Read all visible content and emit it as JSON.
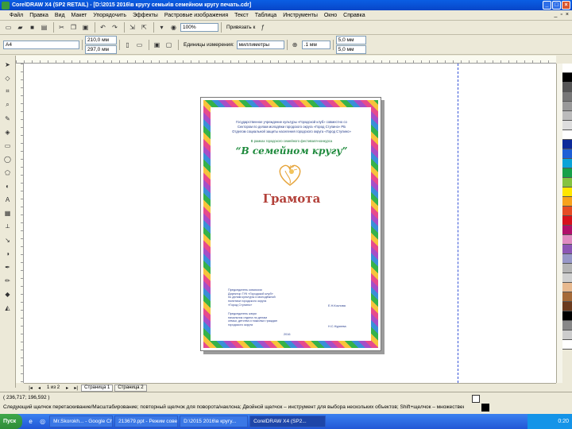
{
  "window": {
    "title": "CorelDRAW X4 (SP2 RETAIL) - [D:\\2015 2016\\в кругу семьи\\в семейном кругу печать.cdr]"
  },
  "menu": {
    "items": [
      "Файл",
      "Правка",
      "Вид",
      "Макет",
      "Упорядочить",
      "Эффекты",
      "Растровые изображения",
      "Текст",
      "Таблица",
      "Инструменты",
      "Окно",
      "Справка"
    ]
  },
  "toolbar1": {
    "zoom": "100%",
    "snap_label": "Привязать к"
  },
  "toolbar2": {
    "paper": "A4",
    "width": "210,0 мм",
    "height": "297,0 мм",
    "units_label": "Единицы измерения:",
    "units": "миллиметры",
    "nudge": ".1 мм",
    "dup_x": "5,0 мм",
    "dup_y": "5,0 мм"
  },
  "document": {
    "header_line1": "Государственное учреждение культуры «Городской клуб» совместно со",
    "header_line2": "Сектором по делам молодёжи городского округа «Город Ступино» РБ",
    "header_line3": "Отделом социальной защиты населения городского округа «Город Ступино»",
    "sub_line": "В рамках городского семейного фестиваля-конкурса",
    "slogan": "“В семейном кругу”",
    "title": "Грамота",
    "signature1": "Председатель комиссии\nДиректор ГУК «Городской клуб»\nпо делам культуры и молодёжной\nполитики городского округа\n«Город Ступино»",
    "signature1_name": "Е.Н.Козлова",
    "signature2": "Председатель жюри\nначальник отдела по делам\nсемьи, детства и пожилых граждан\nгородского округа",
    "signature2_name": "Н.С.Нуриева",
    "signature3": "2016"
  },
  "pages": {
    "counter": "1 из 2",
    "tab1": "Страница 1",
    "tab2": "Страница 2"
  },
  "status": {
    "coords": "( 236,717; 196,592 )",
    "hint": "Следующий щелчок перетаскивание/Масштабирование; повторный щелчок для поворота/наклона; Двойной щелчок – инструмент для выбора нескольких объектов; Shift+щелчок – множественный выбор; Alt+щелчок – выбор цифровой"
  },
  "taskbar": {
    "start": "Пуск",
    "tasks": [
      "Mr.Skorokh... - Google Chr...",
      "213679.ppt - Режим сове...",
      "D:\\2015 2016\\в кругу...",
      "CorelDRAW X4 (SP2..."
    ],
    "clock": "0:20"
  },
  "palette": [
    "#ffffff",
    "#000000",
    "#555555",
    "#777777",
    "#999999",
    "#bbbbbb",
    "#dddddd",
    "#ffffff",
    "#0d2a9a",
    "#1e5fd6",
    "#0aa3d8",
    "#17a04a",
    "#84c341",
    "#ffe600",
    "#f7a21c",
    "#e54c24",
    "#d6111d",
    "#b0106a",
    "#e08bc1",
    "#8c56b4",
    "#9797c7",
    "#b4b4b4",
    "#cfcfcf",
    "#e7b98f",
    "#a56a38",
    "#6b3b1e",
    "#000000",
    "#888888",
    "#cccccc",
    "#ffffff"
  ],
  "colors": {
    "title_blue": "#0846c8",
    "slogan_green": "#1e8a3c",
    "title_red": "#b3413a",
    "guide": "#3553d8"
  }
}
